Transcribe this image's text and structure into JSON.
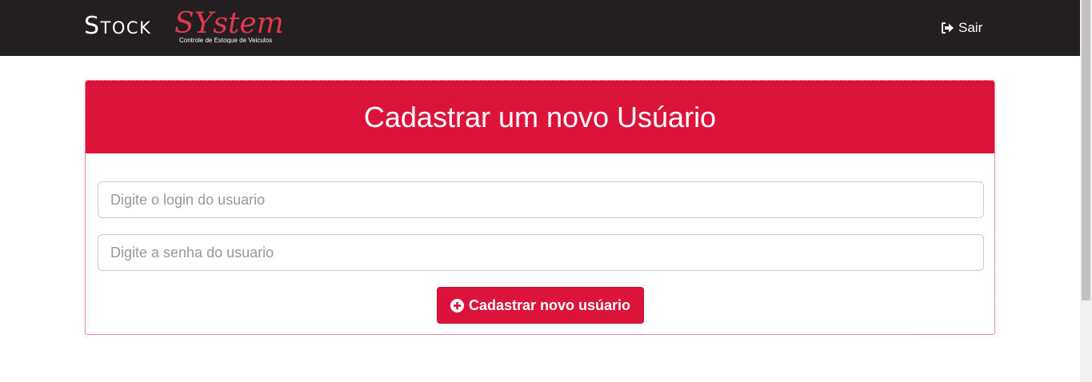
{
  "header": {
    "brand": {
      "word1": "Stock",
      "word2": "SYstem",
      "subtitle": "Controle de Estoque de Veiculos"
    },
    "logout": {
      "icon": "sign-out-icon",
      "label": "Sair"
    }
  },
  "panel": {
    "title": "Cadastrar um novo Usúario",
    "login_field": {
      "value": "",
      "placeholder": "Digite o login do usuario"
    },
    "password_field": {
      "value": "",
      "placeholder": "Digite a senha do usuario"
    },
    "submit": {
      "icon": "plus-circle-icon",
      "label": "Cadastrar novo usúario"
    }
  },
  "colors": {
    "navbar": "#231f20",
    "accent": "#dc143c",
    "brand_accent": "#e0394f"
  }
}
